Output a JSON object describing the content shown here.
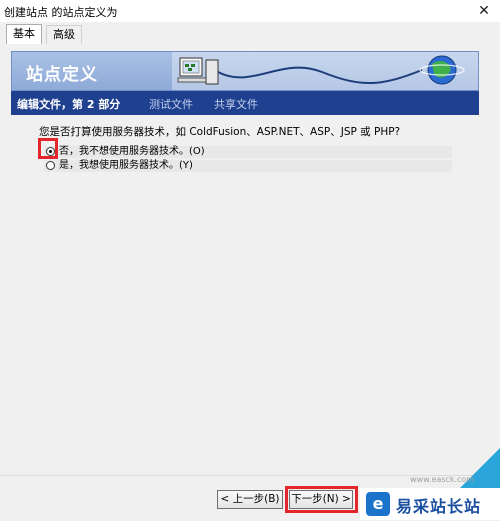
{
  "window": {
    "title": "创建站点 的站点定义为",
    "close_glyph": "✕"
  },
  "tabs": [
    {
      "label": "基本",
      "active": true
    },
    {
      "label": "高级",
      "active": false
    }
  ],
  "banner": {
    "title": "站点定义"
  },
  "steps": [
    {
      "label": "编辑文件，第 2 部分",
      "current": true
    },
    {
      "label": "测试文件",
      "current": false
    },
    {
      "label": "共享文件",
      "current": false
    }
  ],
  "form": {
    "question": "您是否打算使用服务器技术，如 ColdFusion、ASP.NET、ASP、JSP 或 PHP?",
    "options": [
      {
        "label": "否，我不想使用服务器技术。(O)",
        "selected": true
      },
      {
        "label": "是，我想使用服务器技术。(Y)",
        "selected": false
      }
    ]
  },
  "buttons": {
    "back": "< 上一步(B)",
    "next": "下一步(N) >"
  },
  "watermark": {
    "logo_glyph": "e",
    "text": "易采站长站",
    "subtext": "www.easck.com"
  },
  "colors": {
    "step_bar": "#1f3f8f",
    "highlight": "#e2262b",
    "banner": "#8eaad8"
  }
}
